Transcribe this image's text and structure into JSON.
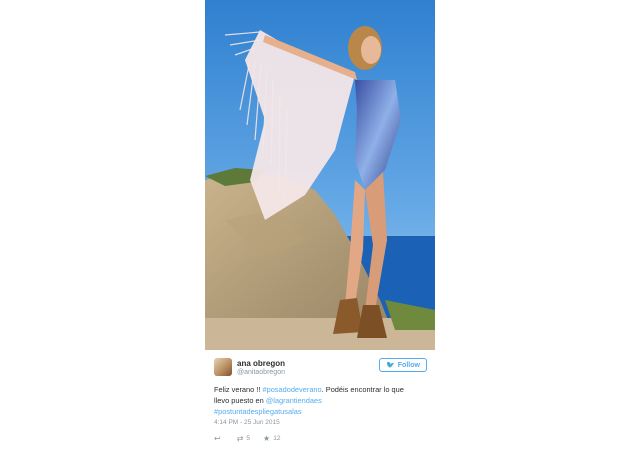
{
  "tweet": {
    "author_name": "ana obregon",
    "author_handle": "@anitaobregon",
    "follow_label": "Follow",
    "text": {
      "line1": "Feliz verano !! ",
      "hashtag1": "#posadodeverano",
      "line1_rest": ". Podéis encontrar lo que",
      "line2": "llevo puesto en ",
      "mention": "@lagrantiendaes",
      "hashtag2": "#postuntadespliegatusalas"
    },
    "timestamp": "4:14 PM - 25 Jun 2015",
    "retweets": "5",
    "favorites": "12"
  },
  "icons": [
    "twitter-bird-icon",
    "reply-icon",
    "retweet-icon",
    "favorite-star-icon"
  ],
  "colors": {
    "accent": "#55acee",
    "text": "#292f33",
    "muted": "#8899a6",
    "sky": "#3f8fd6",
    "sea": "#1b62b7"
  }
}
